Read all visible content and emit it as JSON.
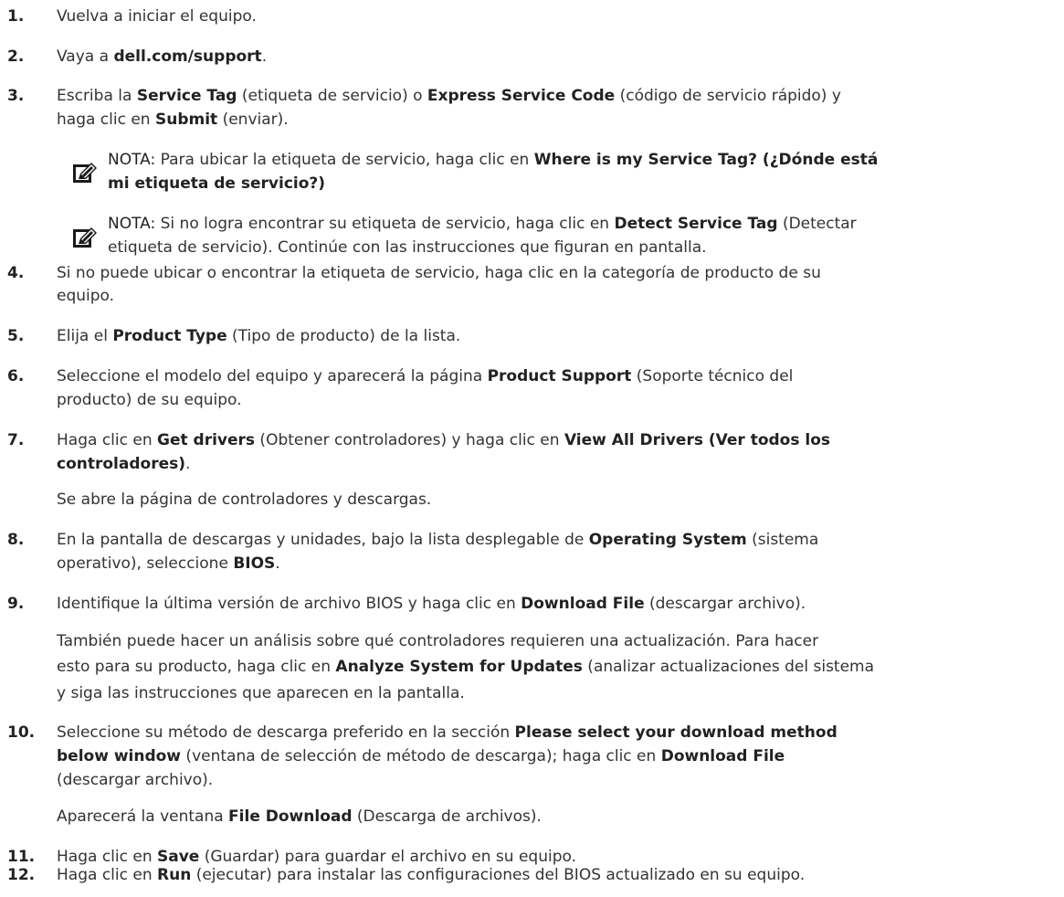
{
  "steps": [
    {
      "num": "1.",
      "lines": [
        [
          {
            "t": "Vuelva a iniciar el equipo."
          }
        ]
      ]
    },
    {
      "num": "2.",
      "lines": [
        [
          {
            "t": "Vaya a "
          },
          {
            "t": "dell.com/support",
            "b": true
          },
          {
            "t": "."
          }
        ]
      ]
    },
    {
      "num": "3.",
      "lines": [
        [
          {
            "t": "Escriba la "
          },
          {
            "t": "Service Tag",
            "b": true
          },
          {
            "t": " (etiqueta de servicio) o "
          },
          {
            "t": "Express Service Code",
            "b": true
          },
          {
            "t": " (código de servicio rápido) y"
          }
        ],
        [
          {
            "t": "haga clic en "
          },
          {
            "t": "Submit",
            "b": true
          },
          {
            "t": " (enviar)."
          }
        ]
      ]
    },
    {
      "num": "4.",
      "lines": [
        [
          {
            "t": "Si no puede ubicar o encontrar la etiqueta de servicio, haga clic en la categoría de producto de su"
          }
        ],
        [
          {
            "t": "equipo."
          }
        ]
      ]
    },
    {
      "num": "5.",
      "lines": [
        [
          {
            "t": "Elija el "
          },
          {
            "t": "Product Type",
            "b": true
          },
          {
            "t": " (Tipo de producto) de la lista."
          }
        ]
      ]
    },
    {
      "num": "6.",
      "lines": [
        [
          {
            "t": "Seleccione el modelo del equipo y aparecerá la página "
          },
          {
            "t": "Product Support",
            "b": true
          },
          {
            "t": " (Soporte técnico del"
          }
        ],
        [
          {
            "t": "producto) de su equipo."
          }
        ]
      ]
    },
    {
      "num": "7.",
      "lines": [
        [
          {
            "t": "Haga clic en "
          },
          {
            "t": "Get drivers",
            "b": true
          },
          {
            "t": " (Obtener controladores) y haga clic en "
          },
          {
            "t": "View All Drivers (Ver todos los",
            "b": true
          }
        ],
        [
          {
            "t": "controladores)",
            "b": true
          },
          {
            "t": "."
          }
        ],
        [
          {
            "t": "Se abre la página de controladores y descargas."
          }
        ]
      ]
    },
    {
      "num": "8.",
      "lines": [
        [
          {
            "t": "En la pantalla de descargas y unidades, bajo la lista desplegable de "
          },
          {
            "t": "Operating System",
            "b": true
          },
          {
            "t": " (sistema"
          }
        ],
        [
          {
            "t": "operativo), seleccione "
          },
          {
            "t": "BIOS",
            "b": true
          },
          {
            "t": "."
          }
        ]
      ]
    },
    {
      "num": "9.",
      "lines": [
        [
          {
            "t": "Identifique la última versión de archivo BIOS y haga clic en "
          },
          {
            "t": "Download File",
            "b": true
          },
          {
            "t": " (descargar archivo)."
          }
        ],
        [
          {
            "t": "También puede hacer un análisis sobre qué controladores requieren una actualización. Para hacer"
          }
        ],
        [
          {
            "t": "esto para su producto, haga clic en "
          },
          {
            "t": "Analyze System for Updates",
            "b": true
          },
          {
            "t": " (analizar actualizaciones del sistema"
          }
        ],
        [
          {
            "t": "y siga las instrucciones que aparecen en la pantalla."
          }
        ]
      ]
    },
    {
      "num": "10.",
      "lines": [
        [
          {
            "t": "Seleccione su método de descarga preferido en la sección "
          },
          {
            "t": "Please select your download method",
            "b": true
          }
        ],
        [
          {
            "t": "below window",
            "b": true
          },
          {
            "t": " (ventana de selección de método de descarga); haga clic en "
          },
          {
            "t": "Download File",
            "b": true
          }
        ],
        [
          {
            "t": "(descargar archivo)."
          }
        ],
        [
          {
            "t": "Aparecerá la ventana "
          },
          {
            "t": "File Download",
            "b": true
          },
          {
            "t": " (Descarga de archivos)."
          }
        ]
      ]
    },
    {
      "num": "11.",
      "lines": [
        [
          {
            "t": "Haga clic en "
          },
          {
            "t": "Save",
            "b": true
          },
          {
            "t": " (Guardar) para guardar el archivo en su equipo."
          }
        ]
      ]
    },
    {
      "num": "12.",
      "lines": [
        [
          {
            "t": "Haga clic en "
          },
          {
            "t": "Run",
            "b": true
          },
          {
            "t": " (ejecutar) para instalar las configuraciones del BIOS actualizado en su equipo."
          }
        ]
      ]
    }
  ],
  "notes": [
    {
      "icon": "note-pencil-icon",
      "lines": [
        [
          {
            "t": "NOTA:",
            "lbl": true
          },
          {
            "t": " Para ubicar la etiqueta de servicio, haga clic en "
          },
          {
            "t": "Where is my Service Tag? (¿Dónde está",
            "b": true
          }
        ],
        [
          {
            "t": "mi etiqueta de servicio?)",
            "b": true
          }
        ]
      ]
    },
    {
      "icon": "note-pencil-icon",
      "lines": [
        [
          {
            "t": "NOTA:",
            "lbl": true
          },
          {
            "t": " Si no logra encontrar su etiqueta de servicio, haga clic en "
          },
          {
            "t": "Detect Service Tag",
            "b": true
          },
          {
            "t": " (Detectar"
          }
        ],
        [
          {
            "t": "etiqueta de servicio). Continúe con las instrucciones que figuran en pantalla."
          }
        ]
      ]
    }
  ]
}
